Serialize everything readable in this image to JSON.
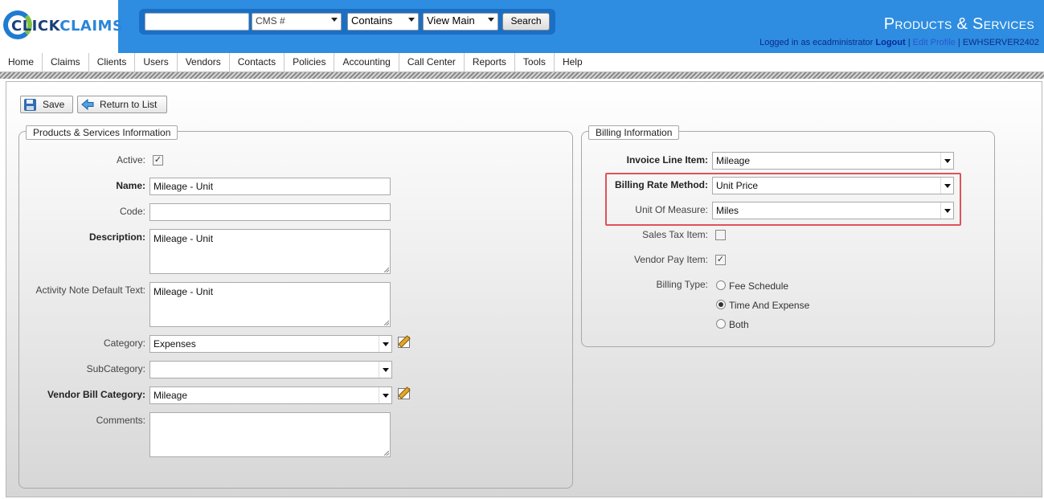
{
  "header": {
    "logo_part1": "CLICK",
    "logo_part2": "CLAIMS",
    "search": {
      "input_value": "",
      "field_select": "CMS #",
      "operator_select": "Contains",
      "view_select": "View Main",
      "button_label": "Search"
    },
    "page_title": "Products & Services",
    "login": {
      "prefix": "Logged in as ecadministrator",
      "logout": "Logout",
      "separator1": "|",
      "edit_profile": "Edit Profile",
      "separator2": "|",
      "server": "EWHSERVER2402"
    }
  },
  "nav": [
    "Home",
    "Claims",
    "Clients",
    "Users",
    "Vendors",
    "Contacts",
    "Policies",
    "Accounting",
    "Call Center",
    "Reports",
    "Tools",
    "Help"
  ],
  "toolbar": {
    "save_label": "Save",
    "return_label": "Return to List"
  },
  "products_info": {
    "legend": "Products & Services Information",
    "active_label": "Active:",
    "active_checked": true,
    "name_label": "Name:",
    "name_value": "Mileage - Unit",
    "code_label": "Code:",
    "code_value": "",
    "description_label": "Description:",
    "description_value": "Mileage - Unit",
    "activity_note_label": "Activity Note Default Text:",
    "activity_note_value": "Mileage - Unit",
    "category_label": "Category:",
    "category_value": "Expenses",
    "subcategory_label": "SubCategory:",
    "subcategory_value": "",
    "vendor_bill_category_label": "Vendor Bill Category:",
    "vendor_bill_category_value": "Mileage",
    "comments_label": "Comments:",
    "comments_value": ""
  },
  "billing_info": {
    "legend": "Billing Information",
    "invoice_line_item_label": "Invoice Line Item:",
    "invoice_line_item_value": "Mileage",
    "billing_rate_method_label": "Billing Rate Method:",
    "billing_rate_method_value": "Unit Price",
    "unit_of_measure_label": "Unit Of Measure:",
    "unit_of_measure_value": "Miles",
    "sales_tax_item_label": "Sales Tax Item:",
    "sales_tax_item_checked": false,
    "vendor_pay_item_label": "Vendor Pay Item:",
    "vendor_pay_item_checked": true,
    "billing_type_label": "Billing Type:",
    "billing_type_options": [
      "Fee Schedule",
      "Time And Expense",
      "Both"
    ],
    "billing_type_selected": "Time And Expense"
  },
  "colors": {
    "header_blue": "#2e8de0",
    "highlight_red": "#e0525a"
  }
}
